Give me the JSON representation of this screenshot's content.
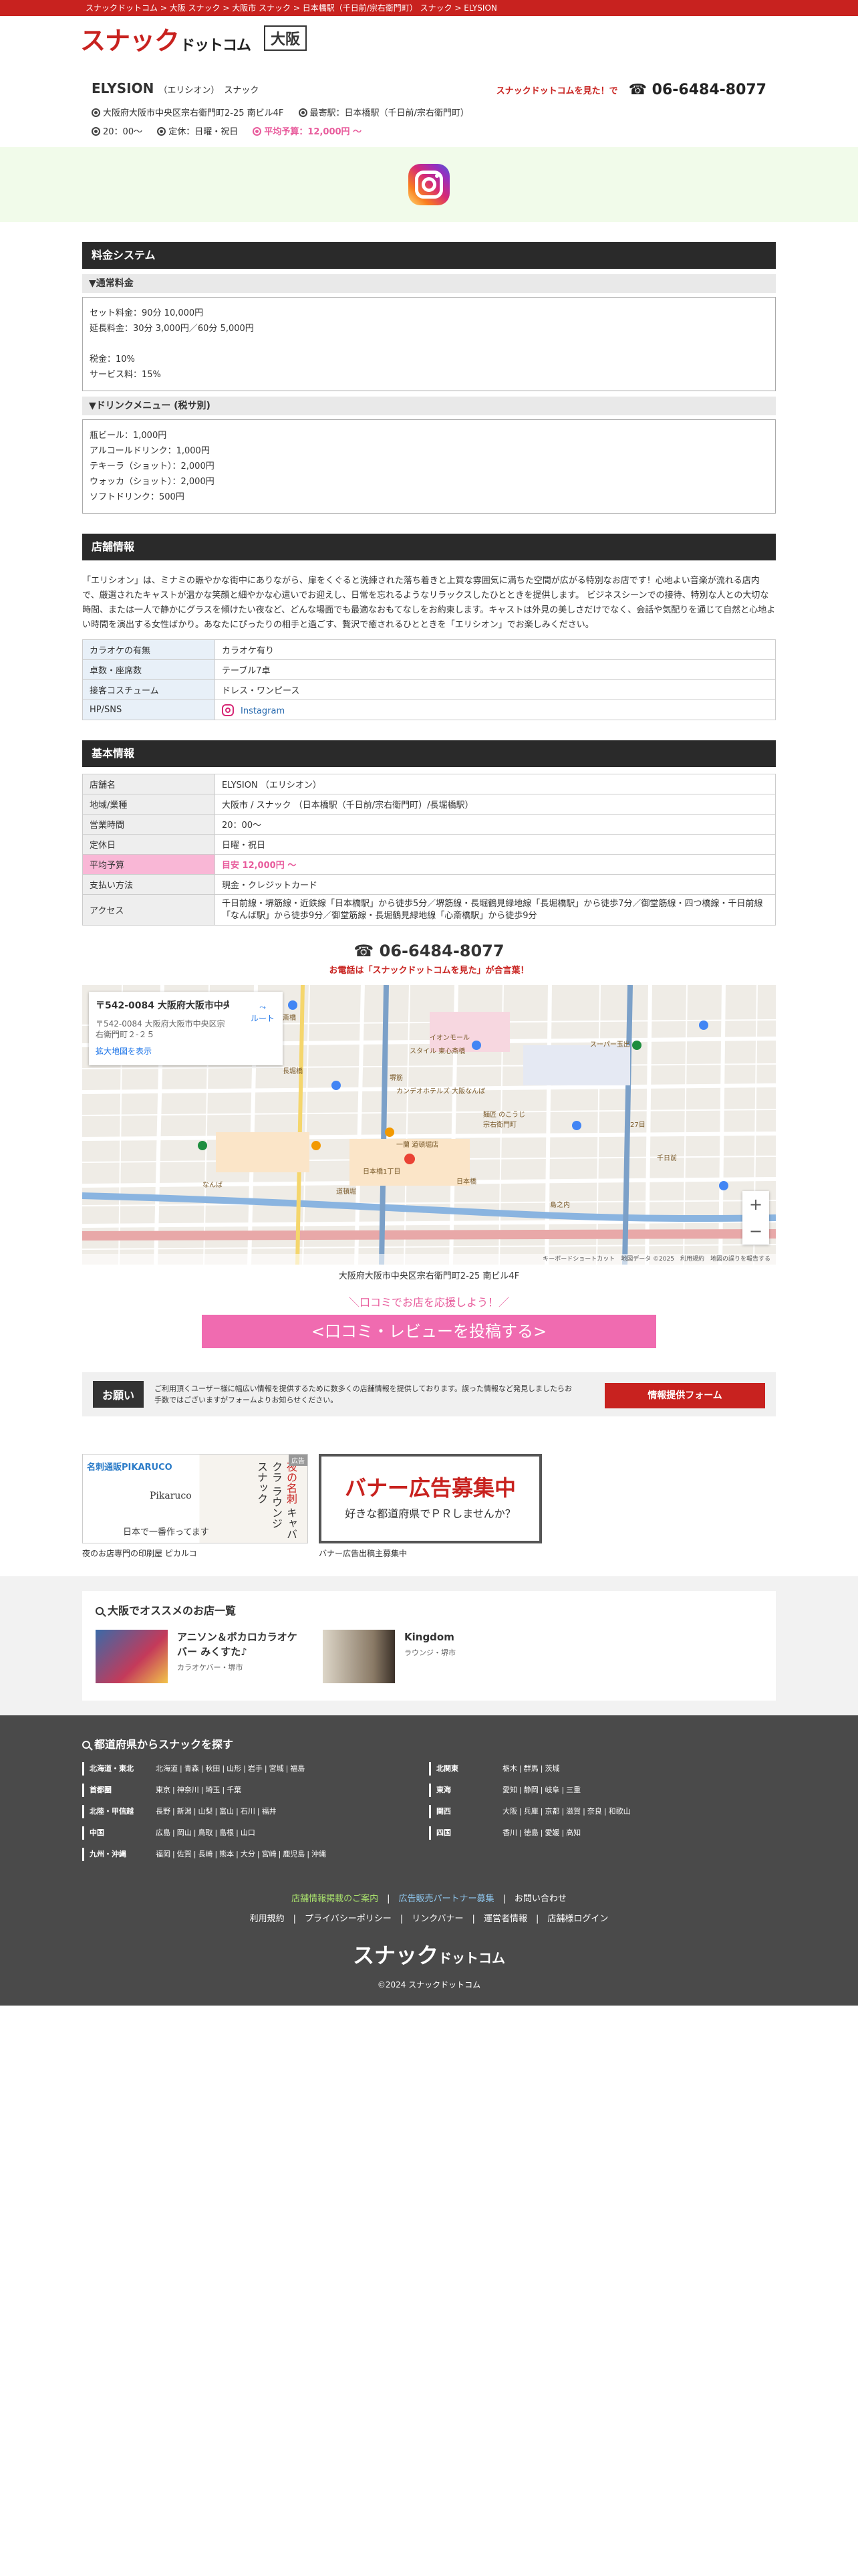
{
  "breadcrumb": [
    "スナックドットコム",
    "大阪 スナック",
    "大阪市 スナック",
    "日本橋駅（千日前/宗右衛門町） スナック",
    "ELYSION"
  ],
  "breadcrumb_sep": " > ",
  "header": {
    "logo_main": "スナック",
    "logo_sub": "ドットコム",
    "area": "大阪"
  },
  "shop": {
    "name": "ELYSION",
    "kana": "（エリシオン）",
    "category": "スナック",
    "tel_note": "スナックドットコムを見た！で",
    "tel": "☎ 06-6484-8077",
    "address": "大阪府大阪市中央区宗右衛門町2-25 南ビル4F",
    "station": "最寄駅：日本橋駅（千日前/宗右衛門町）",
    "hours": "20：00〜",
    "closed": "定休：日曜・祝日",
    "budget": "平均予算：12,000円 〜"
  },
  "price_system": {
    "title": "料金システム",
    "normal_title": "▼通常料金",
    "normal_lines": [
      "セット料金：90分 10,000円",
      "延長料金：30分 3,000円／60分 5,000円",
      "",
      "税金：10%",
      "サービス料：15%"
    ],
    "drink_title": "▼ドリンクメニュー (税サ別)",
    "drink_lines": [
      "瓶ビール：1,000円",
      "アルコールドリンク：1,000円",
      "テキーラ（ショット）：2,000円",
      "ウォッカ（ショット）：2,000円",
      "ソフトドリンク：500円"
    ]
  },
  "store_info": {
    "title": "店舗情報",
    "intro": "「エリシオン」は、ミナミの賑やかな街中にありながら、扉をくぐると洗練された落ち着きと上質な雰囲気に満ちた空間が広がる特別なお店です！心地よい音楽が流れる店内で、厳選されたキャストが温かな笑顔と細やかな心遣いでお迎えし、日常を忘れるようなリラックスしたひとときを提供します。 ビジネスシーンでの接待、特別な人との大切な時間、または一人で静かにグラスを傾けたい夜など、どんな場面でも最適なおもてなしをお約束します。キャストは外見の美しさだけでなく、会話や気配りを通じて自然と心地よい時間を演出する女性ばかり。あなたにぴったりの相手と過ごす、贅沢で癒されるひとときを「エリシオン」でお楽しみください。",
    "rows": [
      {
        "k": "カラオケの有無",
        "v": "カラオケ有り"
      },
      {
        "k": "卓数・座席数",
        "v": "テーブル7卓"
      },
      {
        "k": "接客コスチューム",
        "v": "ドレス・ワンピース"
      }
    ],
    "sns_key": "HP/SNS",
    "sns_val": "Instagram"
  },
  "basic_info": {
    "title": "基本情報",
    "rows": [
      {
        "k": "店舗名",
        "v": "ELYSION （エリシオン）"
      },
      {
        "k": "地域/業種",
        "v": "大阪市 / スナック （日本橋駅（千日前/宗右衛門町）/長堀橋駅）"
      },
      {
        "k": "営業時間",
        "v": "20：00〜"
      },
      {
        "k": "定休日",
        "v": "日曜・祝日"
      }
    ],
    "budget_key": "平均予算",
    "budget_val": "目安 12,000円 〜",
    "payment_key": "支払い方法",
    "payment_val": "現金・クレジットカード",
    "access_key": "アクセス",
    "access_val": "千日前線・堺筋線・近鉄線「日本橋駅」から徒歩5分／堺筋線・長堀鶴見緑地線「長堀橋駅」から徒歩7分／御堂筋線・四つ橋線・千日前線「なんば駅」から徒歩9分／御堂筋線・長堀鶴見緑地線「心斎橋駅」から徒歩9分"
  },
  "tel_block": {
    "tel": "☎ 06-6484-8077",
    "note_pre": "お電話は「",
    "note_mid": "スナックドットコムを見た",
    "note_post": "」が合言葉！"
  },
  "map": {
    "card_title": "〒542-0084 大阪府大阪市中央...",
    "card_addr": "〒542-0084 大阪府大阪市中央区宗右衛門町２-２５",
    "card_link": "拡大地図を表示",
    "route": "ルート",
    "labels": [
      "心斎橋",
      "長堀橋",
      "堺筋",
      "スーパー玉出",
      "イオンモール",
      "スタイル 東心斎橋",
      "カンデオホテルズ 大阪なんば",
      "麺匠 のこうじ",
      "一蘭 道頓堀店",
      "道頓堀",
      "なんば",
      "日本橋",
      "千日前",
      "宗右衛門町",
      "27目",
      "日本橋1丁目",
      "堺筋本町",
      "島之内"
    ],
    "footer": "キーボードショートカット　地図データ ©2025　利用規約　地図の誤りを報告する"
  },
  "address_under_map": "大阪府大阪市中央区宗右衛門町2-25 南ビル4F",
  "review": {
    "caption": "＼口コミでお店を応援しよう！／",
    "button": "<口コミ・レビューを投稿する>"
  },
  "request": {
    "label": "お願い",
    "msg": "ご利用頂くユーザー様に幅広い情報を提供するために数多くの店舗情報を提供しております。誤った情報など発見しましたらお手数ではございますがフォームよりお知らせください。",
    "button": "情報提供フォーム"
  },
  "banners": [
    {
      "tag": "名刺通販PIKARUCO",
      "name": "Pikaruco",
      "slogan": "日本で一番作ってます",
      "vert1": "夜の名刺",
      "vert2": "キャバクラ",
      "vert3": "ラウンジ",
      "vert4": "スナック",
      "ad": "広告",
      "caption": "夜のお店専門の印刷屋 ピカルコ"
    },
    {
      "headline": "バナー広告募集中",
      "sub": "好きな都道府県でＰＲしませんか？",
      "caption": "バナー広告出稿主募集中"
    }
  ],
  "recommend": {
    "title": "大阪でオススメのお店一覧",
    "items": [
      {
        "name": "アニソン＆ボカロカラオケバー みくすた♪",
        "cat": "カラオケバー・堺市"
      },
      {
        "name": "Kingdom",
        "cat": "ラウンジ・堺市"
      }
    ]
  },
  "footer": {
    "title": "都道府県からスナックを探す",
    "left": [
      {
        "reg": "北海道・東北",
        "ps": [
          "北海道",
          "青森",
          "秋田",
          "山形",
          "岩手",
          "宮城",
          "福島"
        ]
      },
      {
        "reg": "首都圏",
        "ps": [
          "東京",
          "神奈川",
          "埼玉",
          "千葉"
        ]
      },
      {
        "reg": "北陸・甲信越",
        "ps": [
          "長野",
          "新潟",
          "山梨",
          "富山",
          "石川",
          "福井"
        ]
      },
      {
        "reg": "中国",
        "ps": [
          "広島",
          "岡山",
          "鳥取",
          "島根",
          "山口"
        ]
      },
      {
        "reg": "九州・沖縄",
        "ps": [
          "福岡",
          "佐賀",
          "長崎",
          "熊本",
          "大分",
          "宮崎",
          "鹿児島",
          "沖縄"
        ]
      }
    ],
    "right": [
      {
        "reg": "北関東",
        "ps": [
          "栃木",
          "群馬",
          "茨城"
        ]
      },
      {
        "reg": "東海",
        "ps": [
          "愛知",
          "静岡",
          "岐阜",
          "三重"
        ]
      },
      {
        "reg": "関西",
        "ps": [
          "大阪",
          "兵庫",
          "京都",
          "滋賀",
          "奈良",
          "和歌山"
        ]
      },
      {
        "reg": "四国",
        "ps": [
          "香川",
          "徳島",
          "愛媛",
          "高知"
        ]
      }
    ],
    "links1": [
      "店舗情報掲載のご案内",
      "広告販売パートナー募集",
      "お問い合わせ"
    ],
    "links2": [
      "利用規約",
      "プライバシーポリシー",
      "リンクバナー",
      "運営者情報",
      "店舗様ログイン"
    ],
    "logo_main": "スナック",
    "logo_sub": "ドットコム",
    "copyright": "©2024 スナックドットコム"
  }
}
